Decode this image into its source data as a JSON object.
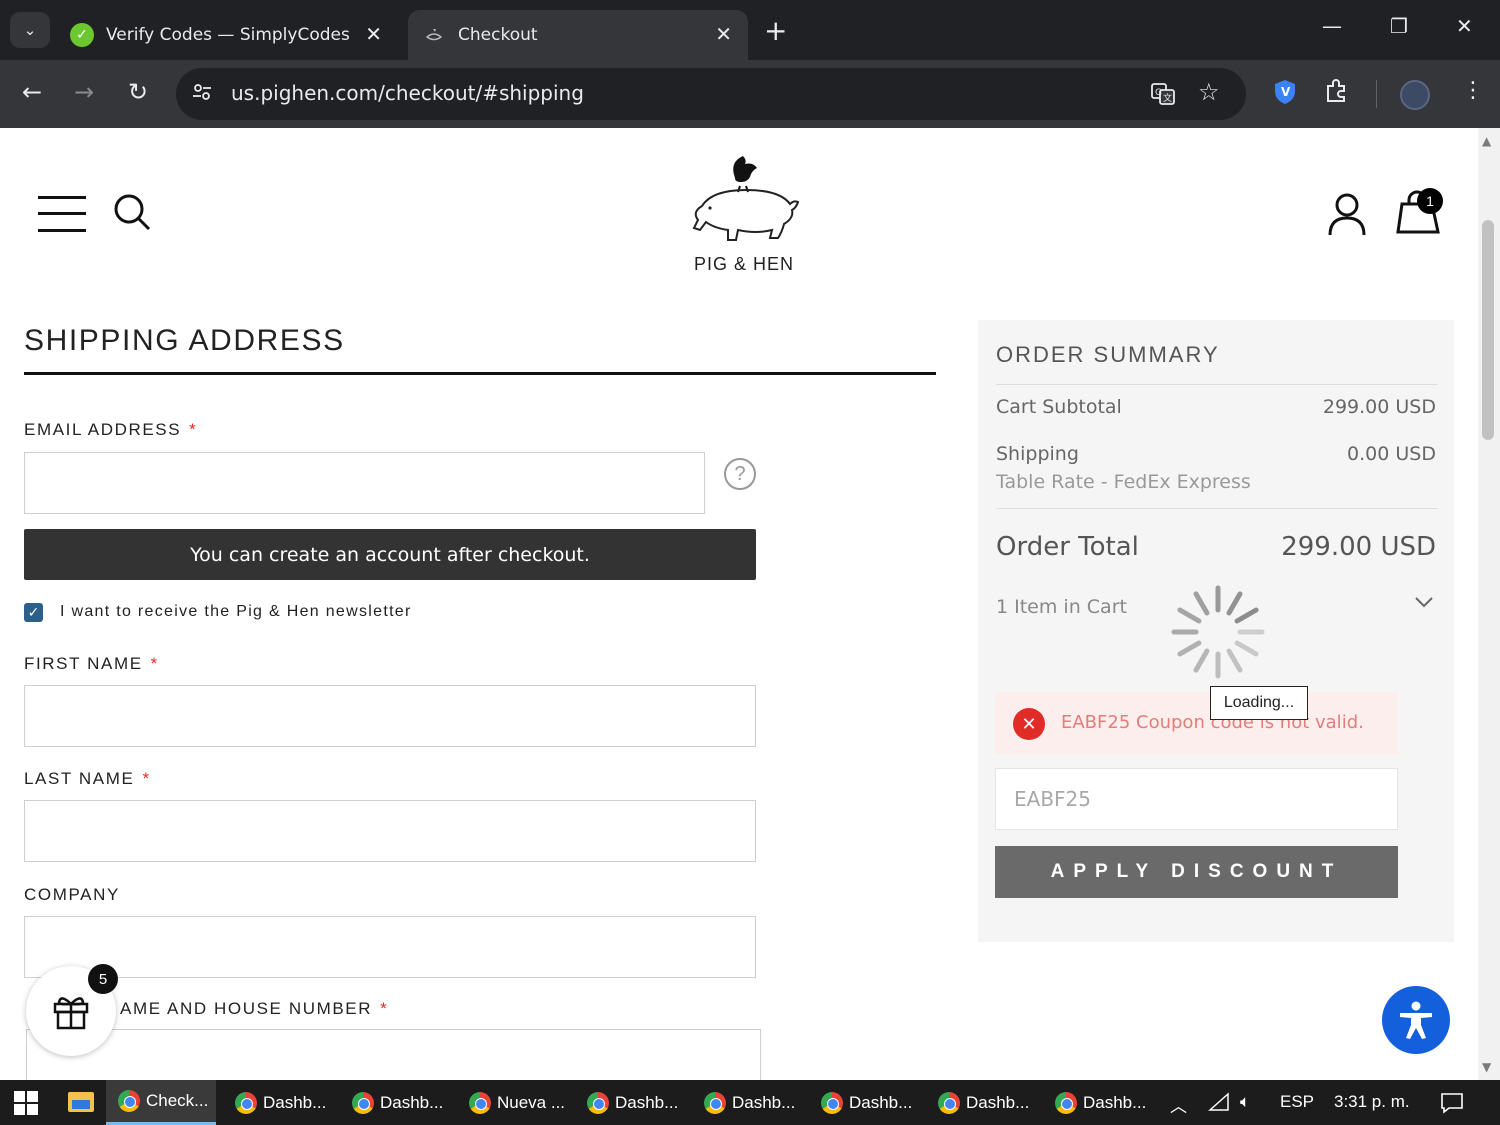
{
  "browser": {
    "tabs": [
      {
        "title": "Verify Codes — SimplyCodes",
        "icon": "simplycodes-check-icon",
        "accent": "#6dc82f"
      },
      {
        "title": "Checkout",
        "icon": "pig-hen-favicon"
      }
    ],
    "url": "us.pighen.com/checkout/#shipping"
  },
  "site": {
    "logo_text": "PIG & HEN",
    "cart_count": "1"
  },
  "shipping": {
    "title": "SHIPPING ADDRESS",
    "email_label": "EMAIL ADDRESS",
    "help_glyph": "?",
    "account_note": "You can create an account after checkout.",
    "newsletter_label": "I want to receive the Pig & Hen newsletter",
    "newsletter_checked": true,
    "first_name_label": "FIRST NAME",
    "last_name_label": "LAST NAME",
    "company_label": "COMPANY",
    "street_label": "AME AND HOUSE NUMBER",
    "required_mark": "*"
  },
  "gift_widget": {
    "badge": "5"
  },
  "summary": {
    "title": "ORDER SUMMARY",
    "subtotal_label": "Cart Subtotal",
    "subtotal_value": "299.00 USD",
    "shipping_label": "Shipping",
    "shipping_value": "0.00 USD",
    "shipping_method": "Table Rate - FedEx Express",
    "total_label": "Order Total",
    "total_value": "299.00 USD",
    "items_label": "1 Item in Cart",
    "loading_text": "Loading...",
    "error_text": "EABF25 Coupon code is not valid.",
    "coupon_value": "EABF25",
    "apply_label": "APPLY DISCOUNT"
  },
  "taskbar": {
    "items": [
      "Check...",
      "Dashb...",
      "Dashb...",
      "Nueva ...",
      "Dashb...",
      "Dashb...",
      "Dashb...",
      "Dashb...",
      "Dashb..."
    ],
    "lang": "ESP",
    "time": "3:31 p. m."
  },
  "colors": {
    "chrome_dark": "#202124",
    "chrome_mid": "#35363a",
    "error_red": "#e02b27",
    "accessibility_blue": "#1460dc",
    "checkbox_blue": "#2c5f8c"
  }
}
